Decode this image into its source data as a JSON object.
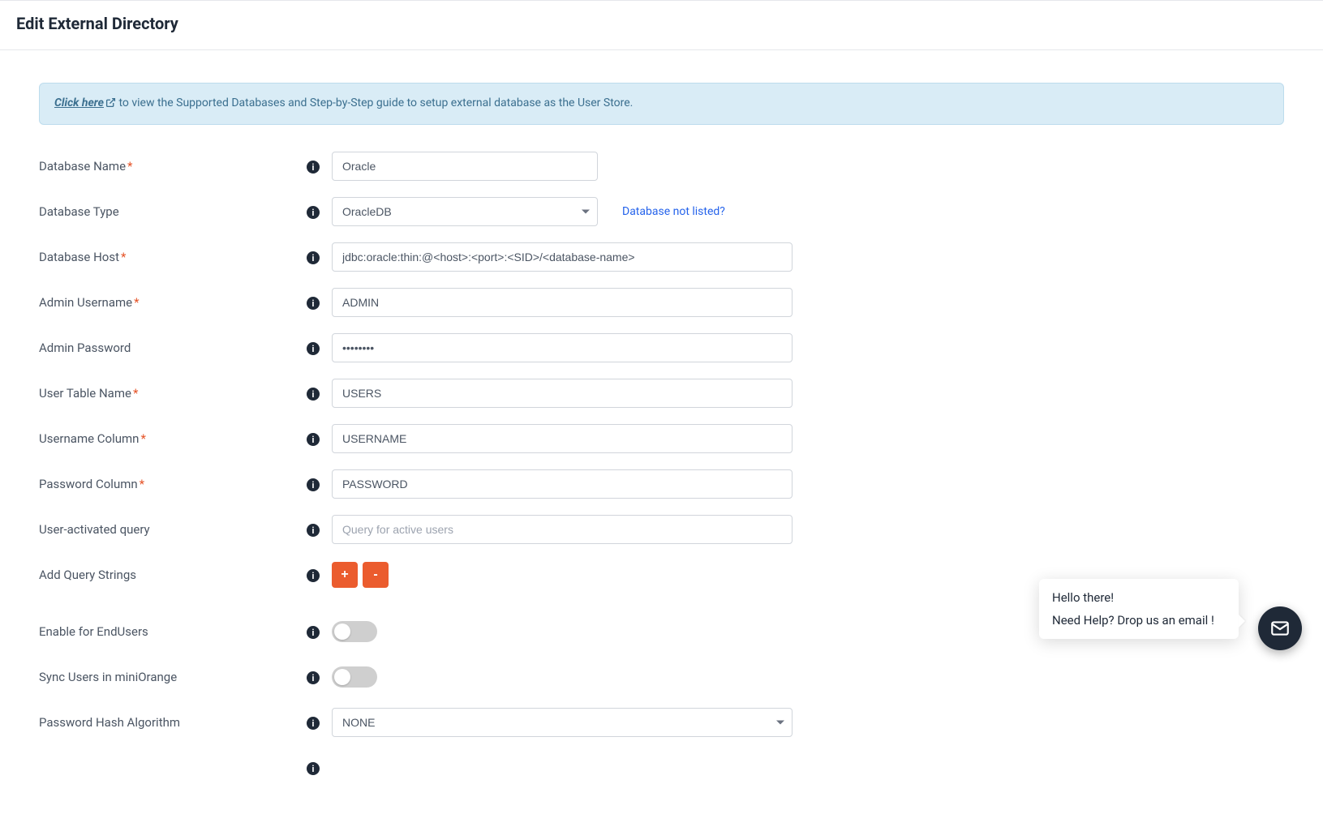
{
  "header": {
    "title": "Edit External Directory"
  },
  "banner": {
    "link_text": "Click here",
    "suffix": " to view the Supported Databases and Step-by-Step guide to setup external database as the User Store."
  },
  "fields": {
    "db_name": {
      "label": "Database Name",
      "value": "Oracle",
      "required": true
    },
    "db_type": {
      "label": "Database Type",
      "value": "OracleDB",
      "extra_link": "Database not listed?"
    },
    "db_host": {
      "label": "Database Host",
      "value": "jdbc:oracle:thin:@<host>:<port>:<SID>/<database-name>",
      "required": true
    },
    "admin_user": {
      "label": "Admin Username",
      "value": "ADMIN",
      "required": true
    },
    "admin_pass": {
      "label": "Admin Password",
      "value": "••••••••"
    },
    "user_table": {
      "label": "User Table Name",
      "value": "USERS",
      "required": true
    },
    "user_col": {
      "label": "Username Column",
      "value": "USERNAME",
      "required": true
    },
    "pass_col": {
      "label": "Password Column",
      "value": "PASSWORD",
      "required": true
    },
    "active_qry": {
      "label": "User-activated query",
      "placeholder": "Query for active users"
    },
    "add_qry": {
      "label": "Add Query Strings",
      "plus": "+",
      "minus": "-"
    },
    "enable_eu": {
      "label": "Enable for EndUsers"
    },
    "sync": {
      "label": "Sync Users in miniOrange"
    },
    "hash": {
      "label": "Password Hash Algorithm",
      "value": "NONE"
    }
  },
  "chat": {
    "line1": "Hello there!",
    "line2": "Need Help? Drop us an email !"
  }
}
